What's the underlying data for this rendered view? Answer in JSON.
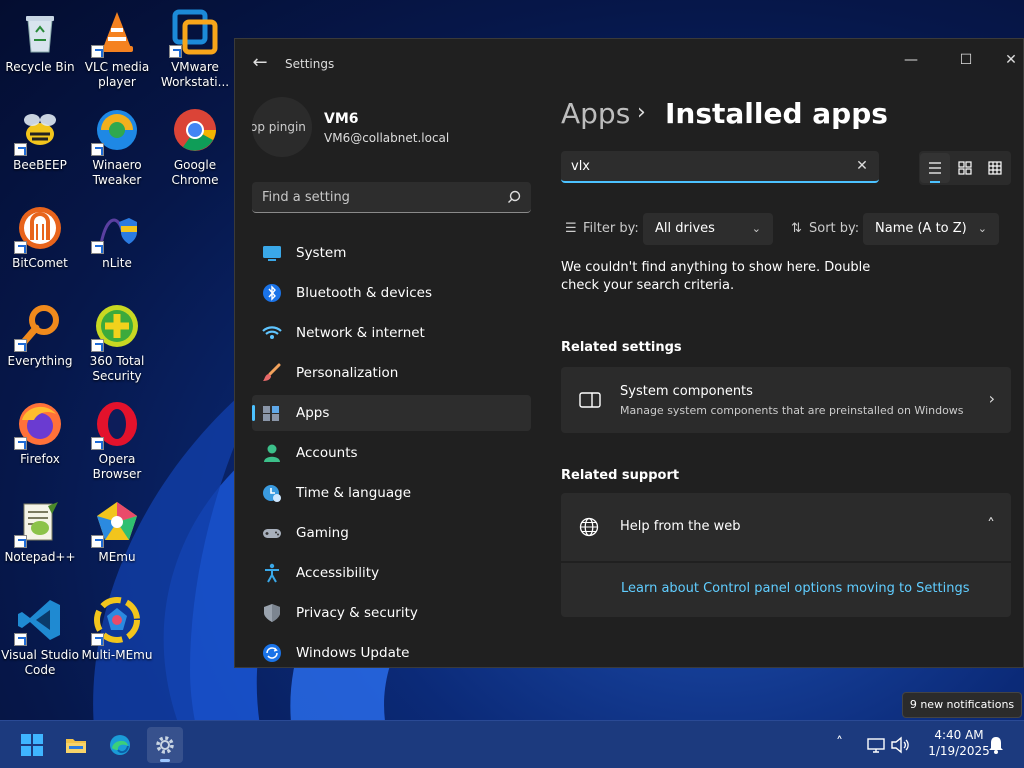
{
  "desktop": {
    "icons": [
      {
        "label": "Recycle Bin",
        "icon": "recycle-bin-icon"
      },
      {
        "label": "VLC media player",
        "icon": "vlc-icon"
      },
      {
        "label": "VMware Workstati...",
        "icon": "vmware-icon"
      },
      {
        "label": "BeeBEEP",
        "icon": "beebeep-icon"
      },
      {
        "label": "Winaero Tweaker",
        "icon": "winaero-tweaker-icon"
      },
      {
        "label": "Google Chrome",
        "icon": "chrome-icon"
      },
      {
        "label": "BitComet",
        "icon": "bitcomet-icon"
      },
      {
        "label": "nLite",
        "icon": "nlite-icon"
      },
      {
        "label": "Everything",
        "icon": "everything-icon"
      },
      {
        "label": "360 Total Security",
        "icon": "360-security-icon"
      },
      {
        "label": "Firefox",
        "icon": "firefox-icon"
      },
      {
        "label": "Opera Browser",
        "icon": "opera-icon"
      },
      {
        "label": "Notepad++",
        "icon": "notepadpp-icon"
      },
      {
        "label": "MEmu",
        "icon": "memu-icon"
      },
      {
        "label": "Visual Studio Code",
        "icon": "vscode-icon"
      },
      {
        "label": "Multi-MEmu",
        "icon": "multi-memu-icon"
      }
    ]
  },
  "window": {
    "title": "Settings",
    "controls": {
      "minimize": "—",
      "maximize": "☐",
      "close": "✕"
    }
  },
  "profile": {
    "avatar_text": "op pingin",
    "name": "VM6",
    "email": "VM6@collabnet.local"
  },
  "sidebar": {
    "search_placeholder": "Find a setting",
    "items": [
      {
        "label": "System",
        "icon": "system-icon"
      },
      {
        "label": "Bluetooth & devices",
        "icon": "bluetooth-icon"
      },
      {
        "label": "Network & internet",
        "icon": "network-icon"
      },
      {
        "label": "Personalization",
        "icon": "personalization-brush-icon"
      },
      {
        "label": "Apps",
        "icon": "apps-icon",
        "selected": true
      },
      {
        "label": "Accounts",
        "icon": "accounts-icon"
      },
      {
        "label": "Time & language",
        "icon": "time-language-icon"
      },
      {
        "label": "Gaming",
        "icon": "gaming-icon"
      },
      {
        "label": "Accessibility",
        "icon": "accessibility-icon"
      },
      {
        "label": "Privacy & security",
        "icon": "shield-icon"
      },
      {
        "label": "Windows Update",
        "icon": "windows-update-icon"
      }
    ]
  },
  "main": {
    "breadcrumb_parent": "Apps",
    "breadcrumb_sep": "›",
    "page_title": "Installed apps",
    "search_value": "vlx",
    "filter_label": "Filter by:",
    "filter_value": "All drives",
    "sort_label": "Sort by:",
    "sort_value": "Name (A to Z)",
    "empty_message": "We couldn't find anything to show here. Double check your search criteria.",
    "related_settings_title": "Related settings",
    "system_components_title": "System components",
    "system_components_sub": "Manage system components that are preinstalled on Windows",
    "related_support_title": "Related support",
    "help_web_title": "Help from the web",
    "help_link": "Learn about Control panel options moving to Settings"
  },
  "taskbar": {
    "notification_toast": "9 new notifications",
    "time": "4:40 AM",
    "date": "1/19/2025"
  },
  "colors": {
    "accent": "#4cc2ff",
    "link": "#60cdff",
    "window_bg": "#202020",
    "card_bg": "#2b2b2b"
  }
}
